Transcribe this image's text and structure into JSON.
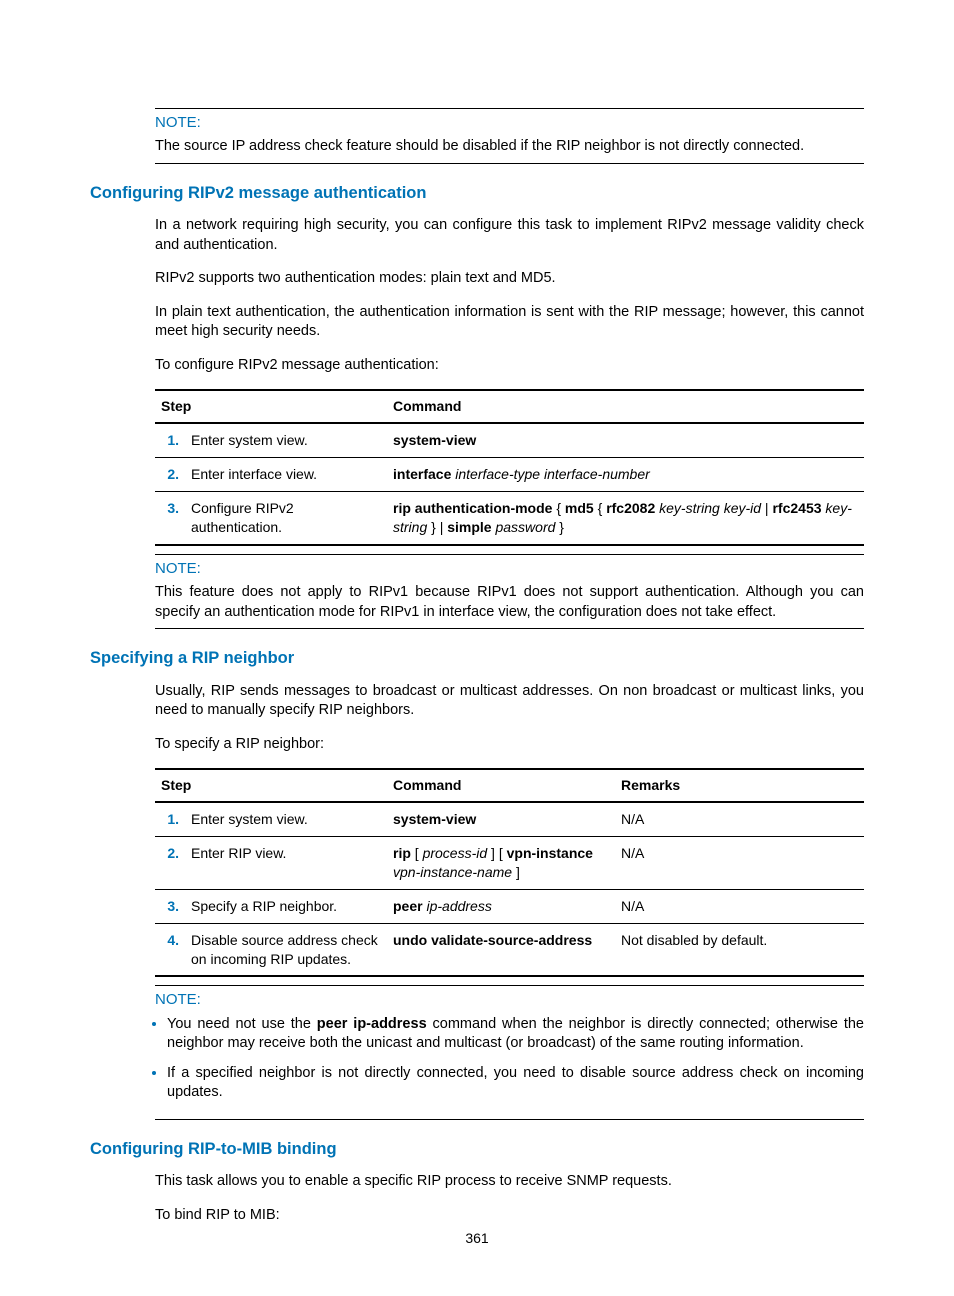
{
  "notes": {
    "label": "NOTE:",
    "note1": "The source IP address check feature should be disabled if the RIP neighbor is not directly connected.",
    "note2": "This feature does not apply to RIPv1 because RIPv1 does not support authentication. Although you can specify an authentication mode for RIPv1 in interface view, the configuration does not take effect.",
    "note3_item1_prefix": "You need not use the ",
    "note3_item1_bold": "peer ip-address",
    "note3_item1_suffix": " command when the neighbor is directly connected; otherwise the neighbor may receive both the unicast and multicast (or broadcast) of the same routing information.",
    "note3_item2": "If a specified neighbor is not directly connected, you need to disable source address check on incoming updates."
  },
  "section1": {
    "title": "Configuring RIPv2 message authentication",
    "p1": "In a network requiring high security, you can configure this task to implement RIPv2 message validity check and authentication.",
    "p2": "RIPv2 supports two authentication modes: plain text and MD5.",
    "p3": "In plain text authentication, the authentication information is sent with the RIP message; however, this cannot meet high security needs.",
    "p4": "To configure RIPv2 message authentication:"
  },
  "table1": {
    "head_step": "Step",
    "head_cmd": "Command",
    "rows": [
      {
        "n": "1.",
        "step": "Enter system view.",
        "cmd_html": "<b>system-view</b>"
      },
      {
        "n": "2.",
        "step": "Enter interface view.",
        "cmd_html": "<b>interface</b> <i>interface-type interface-number</i>"
      },
      {
        "n": "3.",
        "step": "Configure RIPv2 authentication.",
        "cmd_html": "<b>rip authentication-mode</b> { <b>md5</b> { <b>rfc2082</b> <i>key-string key-id</i> | <b>rfc2453</b> <i>key-string</i> } | <b>simple</b> <i>password</i> }"
      }
    ]
  },
  "section2": {
    "title": "Specifying a RIP neighbor",
    "p1": "Usually, RIP sends messages to broadcast or multicast addresses. On non broadcast or multicast links, you need to manually specify RIP neighbors.",
    "p2": "To specify a RIP neighbor:"
  },
  "table2": {
    "head_step": "Step",
    "head_cmd": "Command",
    "head_rem": "Remarks",
    "rows": [
      {
        "n": "1.",
        "step": "Enter system view.",
        "cmd_html": "<b>system-view</b>",
        "rem": "N/A"
      },
      {
        "n": "2.",
        "step": "Enter RIP view.",
        "cmd_html": "<b>rip</b> [ <i>process-id</i> ] [ <b>vpn-instance</b> <i>vpn-instance-name</i> ]",
        "rem": "N/A"
      },
      {
        "n": "3.",
        "step": "Specify a RIP neighbor.",
        "cmd_html": "<b>peer</b> <i>ip-address</i>",
        "rem": "N/A"
      },
      {
        "n": "4.",
        "step": "Disable source address check on incoming RIP updates.",
        "cmd_html": "<b>undo validate-source-address</b>",
        "rem": "Not disabled by default."
      }
    ]
  },
  "section3": {
    "title": "Configuring RIP-to-MIB binding",
    "p1": "This task allows you to enable a specific RIP process to receive SNMP requests.",
    "p2": "To bind RIP to MIB:"
  },
  "pagenum": "361"
}
